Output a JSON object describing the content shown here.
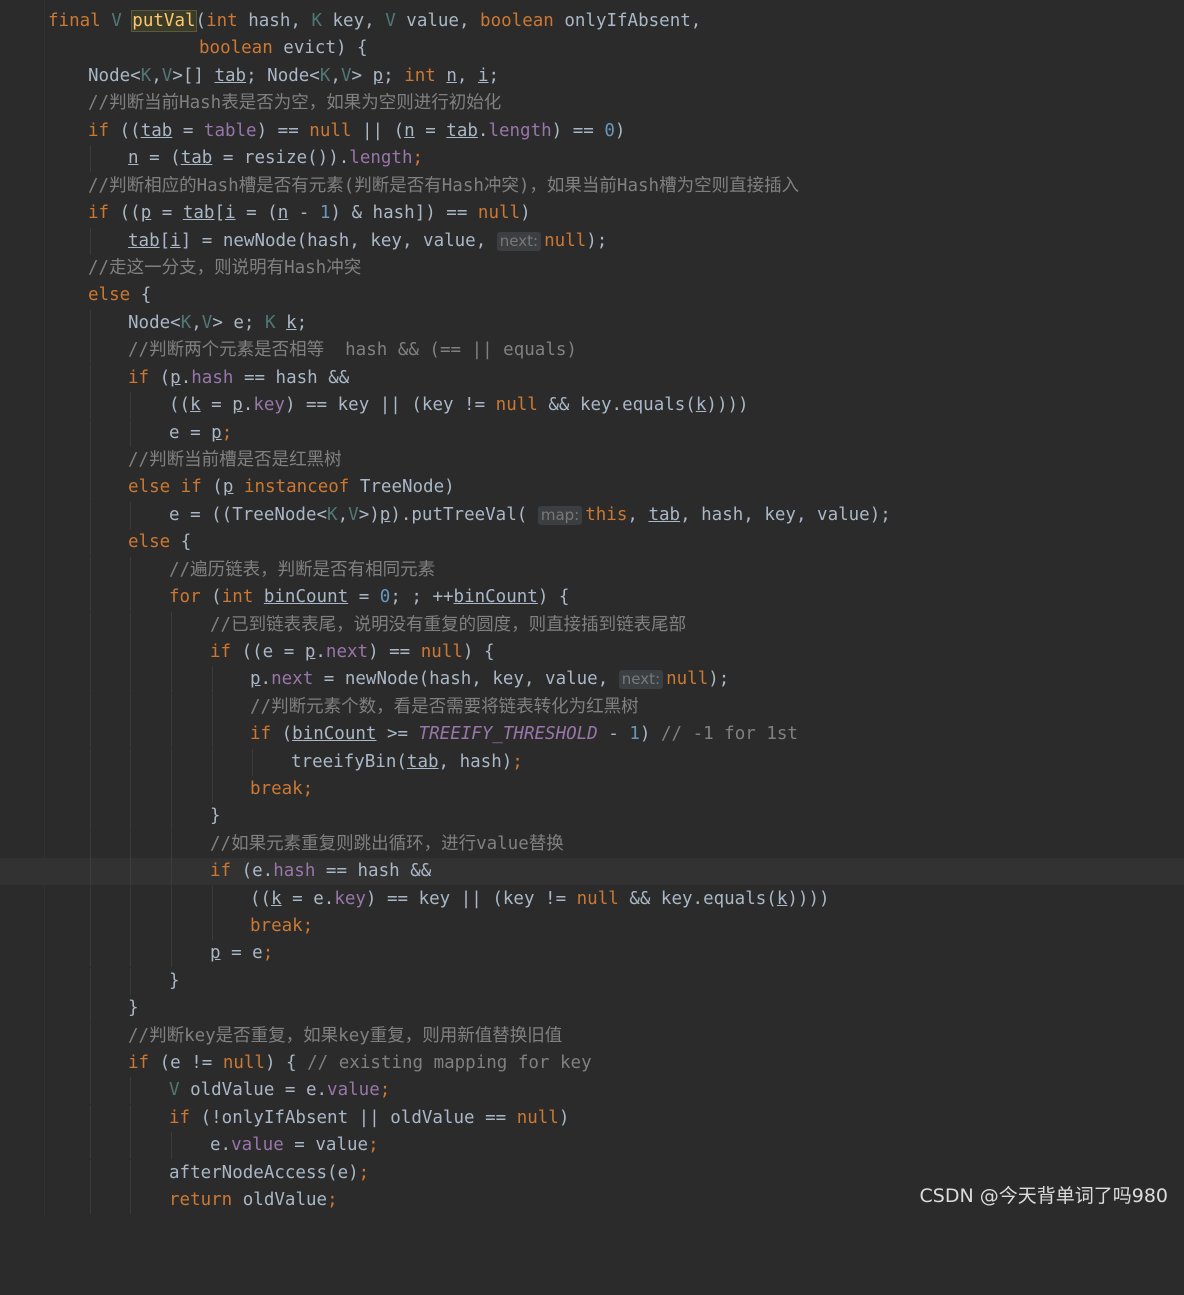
{
  "editor": {
    "lines": [
      "final V putVal(int hash, K key, V value, boolean onlyIfAbsent,",
      "boolean evict) {",
      "Node<K,V>[] tab; Node<K,V> p; int n, i;",
      "//判断当前Hash表是否为空，如果为空则进行初始化",
      "if ((tab = table) == null || (n = tab.length) == 0)",
      "n = (tab = resize()).length;",
      "//判断相应的Hash槽是否有元素(判断是否有Hash冲突)，如果当前Hash槽为空则直接插入",
      "if ((p = tab[i = (n - 1) & hash]) == null)",
      "tab[i] = newNode(hash, key, value, next: null);",
      "//走这一分支，则说明有Hash冲突",
      "else {",
      "Node<K,V> e; K k;",
      "//判断两个元素是否相等  hash && (== || equals)",
      "if (p.hash == hash &&",
      "((k = p.key) == key || (key != null && key.equals(k))))",
      "e = p;",
      "//判断当前槽是否是红黑树",
      "else if (p instanceof TreeNode)",
      "e = ((TreeNode<K,V>)p).putTreeVal( map: this, tab, hash, key, value);",
      "else {",
      "//遍历链表，判断是否有相同元素",
      "for (int binCount = 0; ; ++binCount) {",
      "//已到链表表尾，说明没有重复的圆度，则直接插到链表尾部",
      "if ((e = p.next) == null) {",
      "p.next = newNode(hash, key, value, next: null);",
      "//判断元素个数，看是否需要将链表转化为红黑树",
      "if (binCount >= TREEIFY_THRESHOLD - 1) // -1 for 1st",
      "treeifyBin(tab, hash);",
      "break;",
      "}",
      "//如果元素重复则跳出循环，进行value替换",
      "if (e.hash == hash &&",
      "((k = e.key) == key || (key != null && key.equals(k))))",
      "break;",
      "p = e;",
      "}",
      "}",
      "//判断key是否重复，如果key重复，则用新值替换旧值",
      "if (e != null) { // existing mapping for key",
      "V oldValue = e.value;",
      "if (!onlyIfAbsent || oldValue == null)",
      "e.value = value;",
      "afterNodeAccess(e);",
      "return oldValue;"
    ],
    "hints": {
      "next": "next:",
      "map": "map:"
    },
    "current_line": 32
  },
  "watermark": "CSDN @今天背单词了吗980"
}
